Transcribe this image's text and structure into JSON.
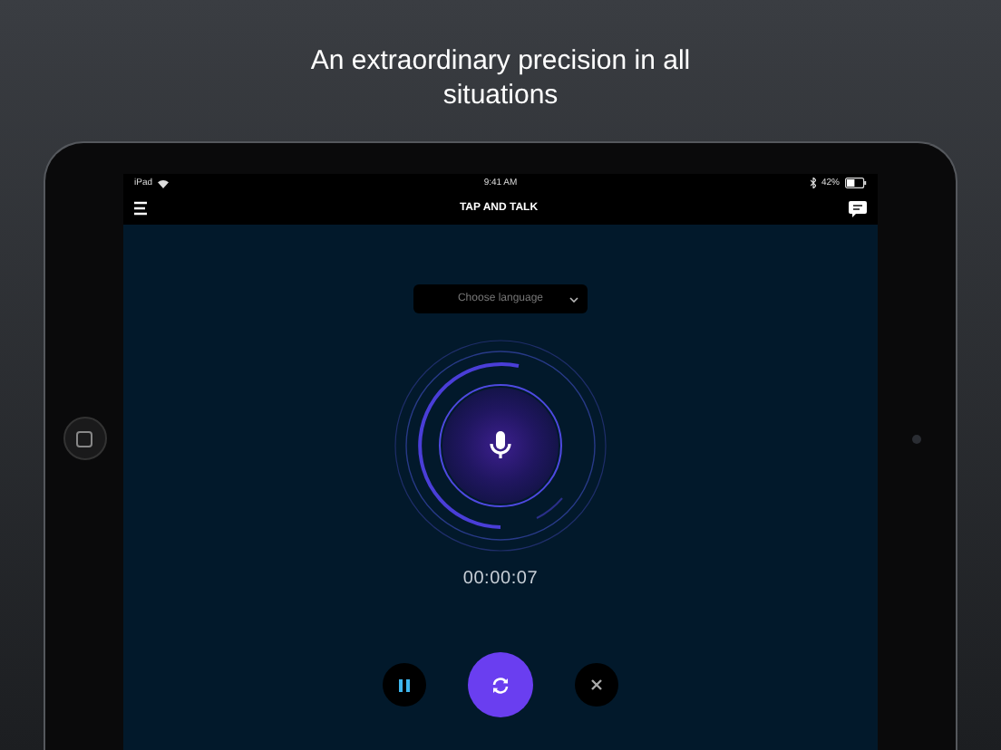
{
  "headline": "An extraordinary precision in all situations",
  "status_bar": {
    "carrier": "iPad",
    "time": "9:41 AM",
    "battery": "42%"
  },
  "nav_bar": {
    "title": "TAP AND TALK"
  },
  "language_select": {
    "placeholder": "Choose language"
  },
  "timer": "00:00:07",
  "controls": [
    {
      "kind": "pause"
    },
    {
      "kind": "swap"
    },
    {
      "kind": "close"
    }
  ]
}
